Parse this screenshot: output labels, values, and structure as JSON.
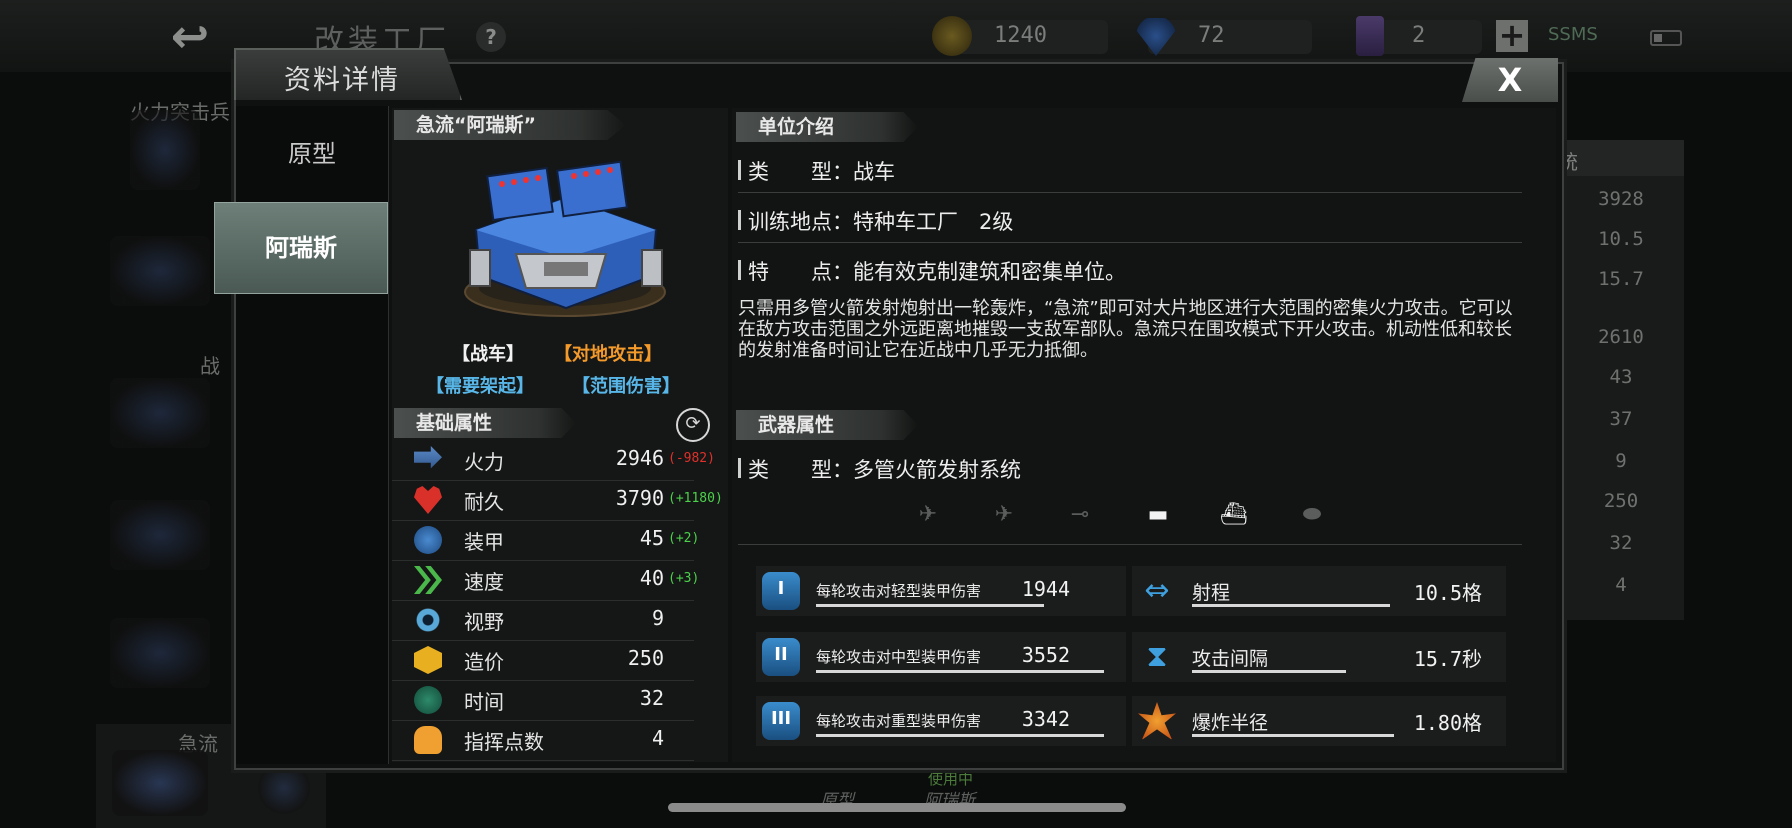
{
  "background": {
    "title": "改装工厂",
    "help": "?",
    "gold": "1240",
    "gems": "72",
    "cards": "2",
    "plus": "+",
    "network": "SSMS",
    "left_labels": [
      "火力突击兵",
      "战",
      "急流"
    ],
    "right_header": "统",
    "right_values": [
      "3928",
      "10.5",
      "15.7",
      "2610",
      "43",
      "37",
      "9",
      "250",
      "32",
      "4"
    ],
    "footer_prototype": "原型",
    "footer_in_use": "使用中",
    "footer_current": "阿瑞斯"
  },
  "dialog": {
    "title": "资料详情",
    "close": "X",
    "tabs": [
      {
        "label": "原型",
        "active": false
      },
      {
        "label": "阿瑞斯",
        "active": true
      }
    ]
  },
  "unit": {
    "name": "急流“阿瑞斯”",
    "tags": [
      {
        "text": "【战车】",
        "color": "#f2f2f2"
      },
      {
        "text": "【对地攻击】",
        "color": "#f39a2b"
      },
      {
        "text": "【需要架起】",
        "color": "#58b7e8"
      },
      {
        "text": "【范围伤害】",
        "color": "#58b7e8"
      }
    ]
  },
  "base_stats": {
    "header": "基础属性",
    "rows": [
      {
        "name": "火力",
        "value": "2946",
        "delta": "(-982)",
        "delta_color": "#e0302a",
        "icon": "firepower-icon"
      },
      {
        "name": "耐久",
        "value": "3790",
        "delta": "(+1180)",
        "delta_color": "#4bd14b",
        "icon": "heart-icon"
      },
      {
        "name": "装甲",
        "value": "45",
        "delta": "(+2)",
        "delta_color": "#4bd14b",
        "icon": "armor-icon"
      },
      {
        "name": "速度",
        "value": "40",
        "delta": "(+3)",
        "delta_color": "#4bd14b",
        "icon": "speed-icon"
      },
      {
        "name": "视野",
        "value": "9",
        "delta": "",
        "delta_color": "#4bd14b",
        "icon": "eye-icon"
      },
      {
        "name": "造价",
        "value": "250",
        "delta": "",
        "delta_color": "#4bd14b",
        "icon": "cost-icon"
      },
      {
        "name": "时间",
        "value": "32",
        "delta": "",
        "delta_color": "#4bd14b",
        "icon": "time-icon"
      },
      {
        "name": "指挥点数",
        "value": "4",
        "delta": "",
        "delta_color": "#4bd14b",
        "icon": "command-points-icon"
      }
    ]
  },
  "intro": {
    "header": "单位介绍",
    "type": "类　　型：战车",
    "training": "训练地点：特种车工厂　2级",
    "feature": "特　　点：能有效克制建筑和密集单位。",
    "description": "只需用多管火箭发射炮射出一轮轰炸，“急流”即可对大片地区进行大范围的密集火力攻击。它可以在敌方攻击范围之外远距离地摧毁一支敌军部队。急流只在围攻模式下开火攻击。机动性低和较长的发射准备时间让它在近战中几乎无力抵御。"
  },
  "weapon": {
    "header": "武器属性",
    "type": "类　　型：多管火箭发射系统",
    "targets": [
      {
        "icon": "fighter-jet-icon",
        "active": false
      },
      {
        "icon": "bomber-plane-icon",
        "active": false
      },
      {
        "icon": "helicopter-icon",
        "active": false
      },
      {
        "icon": "tank-icon",
        "active": true
      },
      {
        "icon": "ship-icon",
        "active": true
      },
      {
        "icon": "submarine-icon",
        "active": false
      }
    ],
    "damage": [
      {
        "label": "每轮攻击对轻型装甲伤害",
        "value": "1944",
        "icon": "light-armor-icon",
        "numeral": "I"
      },
      {
        "label": "每轮攻击对中型装甲伤害",
        "value": "3552",
        "icon": "medium-armor-icon",
        "numeral": "II"
      },
      {
        "label": "每轮攻击对重型装甲伤害",
        "value": "3342",
        "icon": "heavy-armor-icon",
        "numeral": "III"
      }
    ],
    "props": [
      {
        "label": "射程",
        "value": "10.5格",
        "icon": "range-icon"
      },
      {
        "label": "攻击间隔",
        "value": "15.7秒",
        "icon": "hourglass-icon"
      },
      {
        "label": "爆炸半径",
        "value": "1.80格",
        "icon": "blast-radius-icon"
      }
    ]
  }
}
